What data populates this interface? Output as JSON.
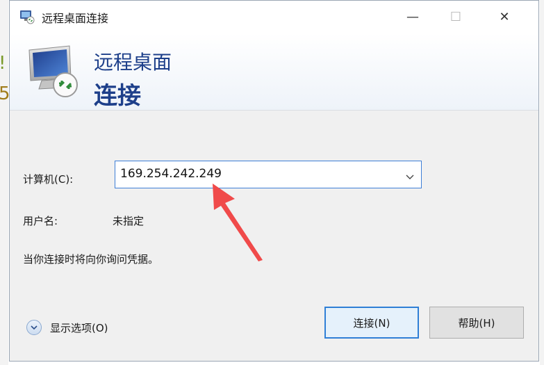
{
  "window": {
    "title": "远程桌面连接",
    "controls": {
      "minimize": "—",
      "maximize": "☐",
      "close": "✕"
    }
  },
  "banner": {
    "line1": "远程桌面",
    "line2": "连接"
  },
  "form": {
    "computer_label": "计算机(C):",
    "computer_value": "169.254.242.249",
    "user_label": "用户名:",
    "user_value": "未指定",
    "prompt": "当你连接时将向你询问凭据。"
  },
  "footer": {
    "show_options": "显示选项(O)",
    "connect_button": "连接(N)",
    "help_button": "帮助(H)"
  },
  "colors": {
    "banner_text": "#1d3f8a",
    "focus_border": "#3d7ed6",
    "annotation_arrow": "#f04a4a"
  },
  "icons": {
    "title": "remote-desktop-icon",
    "banner": "remote-desktop-monitor-icon",
    "combo": "chevron-down-icon",
    "options": "expand-circle-icon"
  }
}
